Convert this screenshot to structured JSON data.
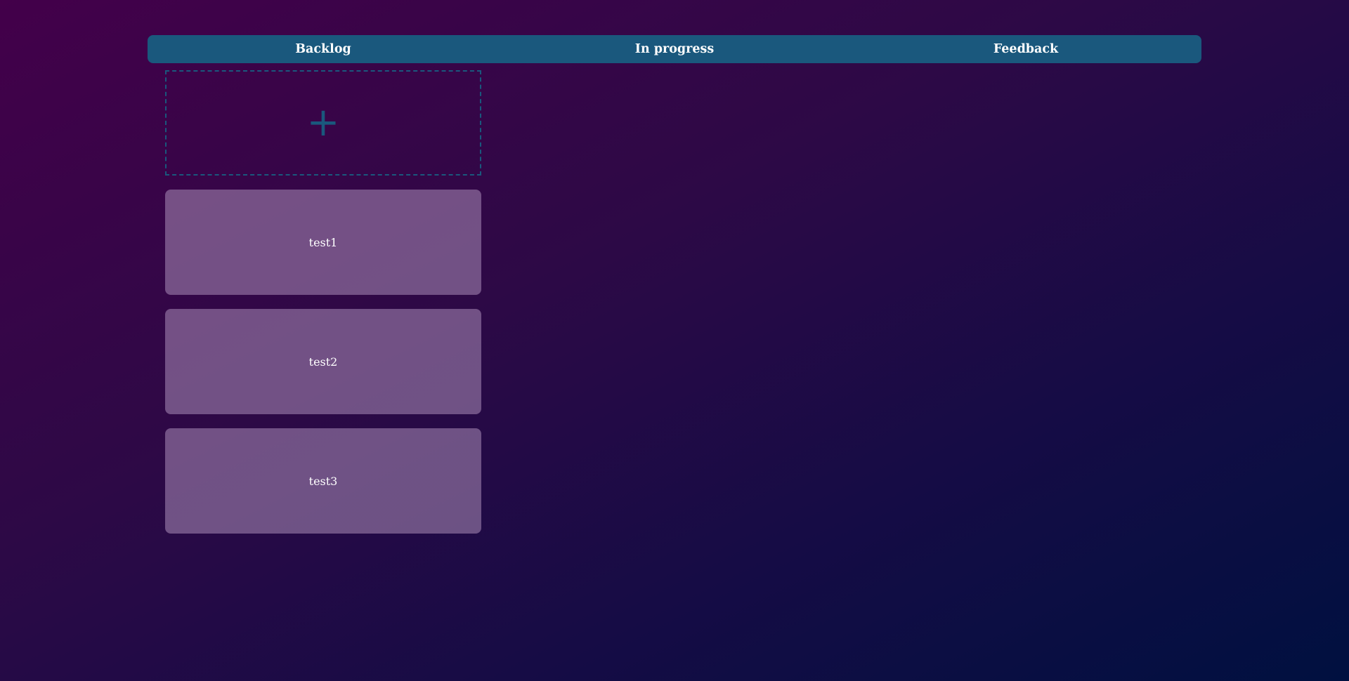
{
  "board": {
    "columns": [
      {
        "title": "Backlog"
      },
      {
        "title": "In progress"
      },
      {
        "title": "Feedback"
      }
    ],
    "add_card": {
      "icon": "plus-icon",
      "glyph": "+"
    },
    "backlog_cards": [
      {
        "label": "test1"
      },
      {
        "label": "test2"
      },
      {
        "label": "test3"
      }
    ]
  },
  "colors": {
    "header": "#1a587d",
    "card": "rgba(160,130,175,0.6)",
    "accent": "#1a587d"
  }
}
